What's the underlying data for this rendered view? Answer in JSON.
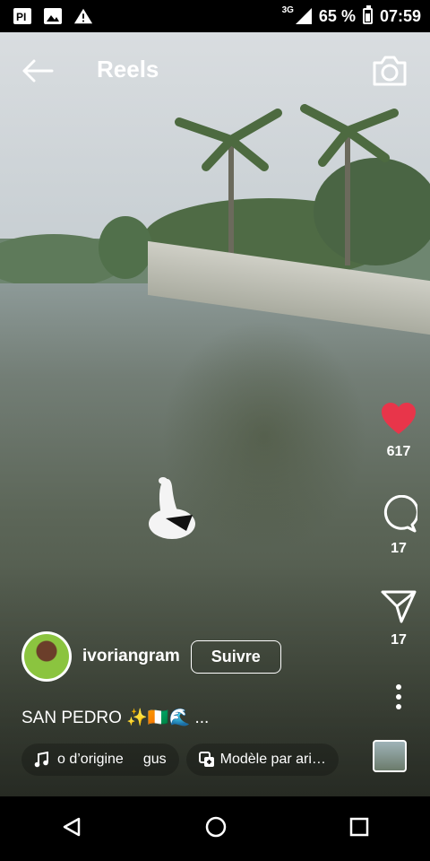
{
  "status_bar": {
    "network": "3G",
    "battery": "65 %",
    "time": "07:59",
    "icons": [
      "pi-app-icon",
      "image-icon",
      "warning-icon",
      "signal-icon",
      "battery-icon"
    ]
  },
  "header": {
    "title": "Reels",
    "icons": {
      "back": "arrow-left-icon",
      "camera": "camera-icon"
    }
  },
  "actions": {
    "like_count": "617",
    "comment_count": "17",
    "share_count": "17",
    "like_color": "#e8354a"
  },
  "author": {
    "username": "ivoriangram",
    "follow_label": "Suivre"
  },
  "caption": "SAN PEDRO ✨🇨🇮🌊 ...",
  "chips": {
    "audio_left": "o d’origine",
    "audio_right": "gus",
    "template": "Modèle par ari…"
  },
  "navbar": {
    "icons": [
      "back-triangle-icon",
      "home-circle-icon",
      "recents-square-icon"
    ]
  }
}
